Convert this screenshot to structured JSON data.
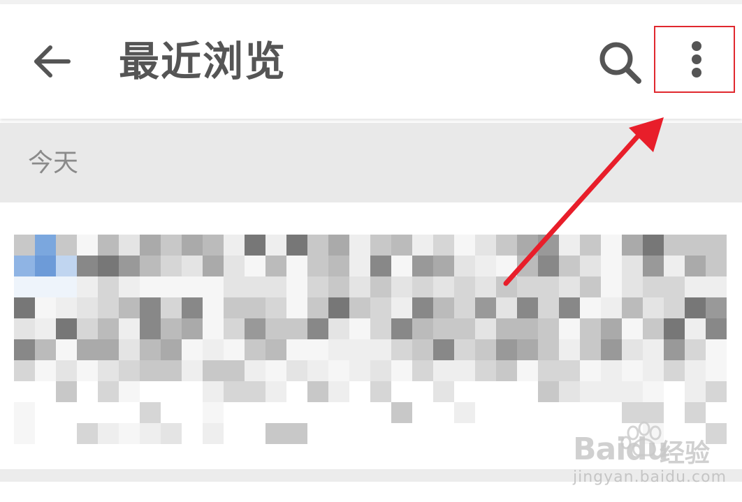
{
  "app_bar": {
    "title": "最近浏览",
    "back_icon": "arrow-left-icon",
    "search_icon": "search-icon",
    "more_icon": "more-vert-icon"
  },
  "section": {
    "label": "今天"
  },
  "list": {
    "items": [
      {
        "content": "pixelated-history-entry"
      }
    ]
  },
  "annotation": {
    "highlight_color": "#e0282e",
    "arrow_color": "#e81e2a"
  },
  "watermark": {
    "brand": "Baidu",
    "product": "经验",
    "url": "jingyan.baidu.com"
  },
  "colors": {
    "title": "#555555",
    "icon": "#555555",
    "section_bg": "#e9e9e9",
    "section_text": "#8a8a8a"
  }
}
